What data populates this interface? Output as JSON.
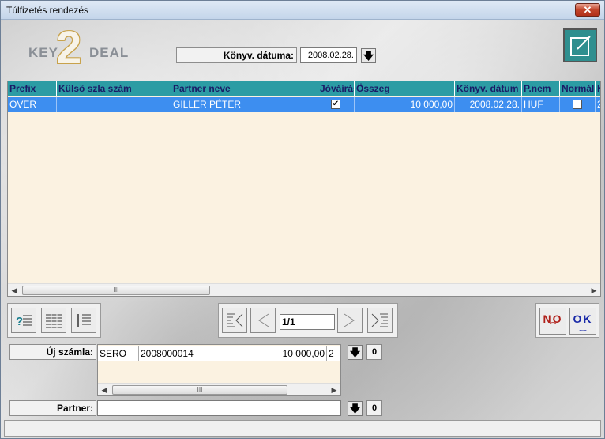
{
  "window": {
    "title": "Túlfizetés rendezés",
    "close_label": "✕"
  },
  "logo": {
    "key": "KEY",
    "two": "2",
    "deal": "DEAL"
  },
  "header": {
    "date_label": "Könyv. dátuma:",
    "date_value": "2008.02.28."
  },
  "grid": {
    "columns": [
      "Prefix",
      "Külső szla szám",
      "Partner neve",
      "Jóváírás",
      "Összeg",
      "Könyv. dátum",
      "P.nem",
      "Normál",
      "K"
    ],
    "rows": [
      {
        "prefix": "OVER",
        "kulso_szla_szam": "",
        "partner_neve": "GILLER PÉTER",
        "jovairas": true,
        "osszeg": "10 000,00",
        "konyv_datum": "2008.02.28.",
        "p_nem": "HUF",
        "normal": false,
        "k": "2"
      }
    ],
    "scroll_thumb": "III"
  },
  "navigator": {
    "page": "1/1"
  },
  "buttons": {
    "no_label": "NO",
    "ok_label": "OK"
  },
  "uj_szamla": {
    "label": "Új számla:",
    "row": {
      "prefix": "SERO",
      "szam": "2008000014",
      "osszeg": "10 000,00",
      "extra": "2"
    },
    "zero": "0",
    "scroll_thumb": "III"
  },
  "partner": {
    "label": "Partner:",
    "value": "",
    "zero": "0"
  },
  "icons": {
    "grid_tools": [
      "help-list-icon",
      "columns-list-icon",
      "sort-list-icon"
    ],
    "nav": [
      "first-page-icon",
      "prev-page-icon",
      "next-page-icon",
      "last-page-icon"
    ],
    "top_right": "edit-form-icon"
  }
}
